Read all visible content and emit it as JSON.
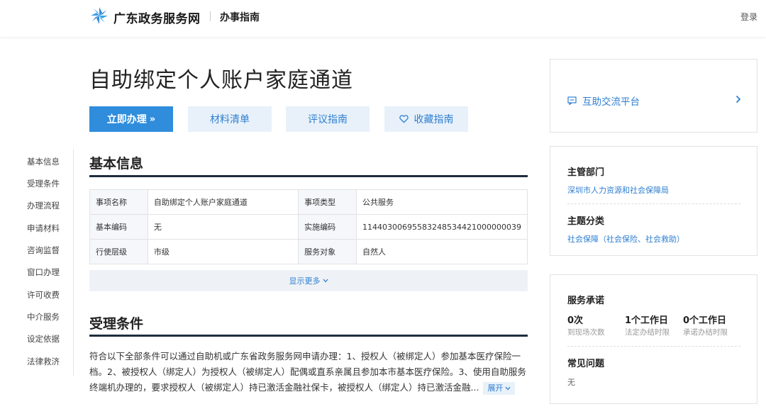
{
  "header": {
    "site_name": "广东政务服务网",
    "section": "办事指南",
    "login": "登录",
    "logo_icon": "pinwheel-logo-icon"
  },
  "page_title": "自助绑定个人账户家庭通道",
  "actions": {
    "apply": "立即办理",
    "apply_glyph": "»",
    "materials": "材料清单",
    "review": "评议指南",
    "favorite": "收藏指南"
  },
  "left_nav": [
    "基本信息",
    "受理条件",
    "办理流程",
    "申请材料",
    "咨询监督",
    "窗口办理",
    "许可收费",
    "中介服务",
    "设定依据",
    "法律救济"
  ],
  "basic_info": {
    "title": "基本信息",
    "rows": [
      [
        "事项名称",
        "自助绑定个人账户家庭通道",
        "事项类型",
        "公共服务"
      ],
      [
        "基本编码",
        "无",
        "实施编码",
        "11440300695583248534421000000039"
      ],
      [
        "行使层级",
        "市级",
        "服务对象",
        "自然人"
      ]
    ],
    "show_more": "显示更多"
  },
  "conditions": {
    "title": "受理条件",
    "lines": [
      "符合以下全部条件可以通过自助机或广东省政务服务网申请办理：1、授权人（被绑定人）参加基本医疗保险一",
      "档。2、被授权人（绑定人）为授权人（被绑定人）配偶或直系亲属且参加本市基本医疗保险。3、使用自助服务",
      "终端机办理的，要求授权人（被绑定人）持已激活金融社保卡，被授权人（绑定人）持已激活金融..."
    ],
    "expand": "展开"
  },
  "sidebar": {
    "platform": "互助交流平台",
    "dept_title": "主管部门",
    "dept": "深圳市人力资源和社会保障局",
    "topic_title": "主题分类",
    "topic": "社会保障（社会保险、社会救助）",
    "promise_title": "服务承诺",
    "stats": [
      {
        "value": "0次",
        "label": "到现场次数"
      },
      {
        "value": "1个工作日",
        "label": "法定办结时限"
      },
      {
        "value": "0个工作日",
        "label": "承诺办结时限"
      }
    ],
    "faq_title": "常见问题",
    "faq_value": "无"
  },
  "colors": {
    "primary": "#2f8ddc",
    "link": "#2f7fd0",
    "light_button": "#e8f1fa",
    "section_line": "#1f2d3d"
  }
}
